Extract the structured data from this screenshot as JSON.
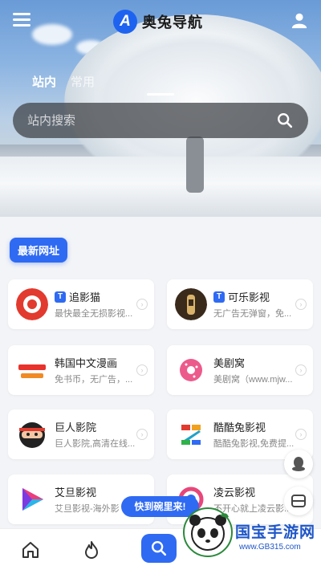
{
  "header": {
    "app_name": "奥兔导航",
    "logo_letter": "A",
    "tabs": [
      {
        "label": "站内",
        "active": true
      },
      {
        "label": "常用",
        "active": false
      }
    ]
  },
  "search": {
    "placeholder": "站内搜索"
  },
  "section": {
    "latest_label": "最新网址"
  },
  "cards": [
    {
      "title": "追影猫",
      "badge": "T",
      "desc": "最快最全无损影视...",
      "icon": "zhuiyingmao-logo"
    },
    {
      "title": "可乐影视",
      "badge": "T",
      "desc": "无广告无弹窗，免...",
      "icon": "kele-bottle-logo"
    },
    {
      "title": "韩国中文漫画",
      "badge": "",
      "desc": "免书币，无广告，...",
      "icon": "toptoon-logo"
    },
    {
      "title": "美剧窝",
      "badge": "",
      "desc": "美剧窝（www.mjw...",
      "icon": "donut-logo"
    },
    {
      "title": "巨人影院",
      "badge": "",
      "desc": "巨人影院,高清在线...",
      "icon": "ninja-logo"
    },
    {
      "title": "酷酷兔影视",
      "badge": "",
      "desc": "酷酷兔影视,免费提...",
      "icon": "z-logo"
    },
    {
      "title": "艾旦影视",
      "badge": "",
      "desc": "艾旦影视-海外影",
      "icon": "play-logo"
    },
    {
      "title": "凌云影视",
      "badge": "",
      "desc": "不开心就上凌云影...",
      "icon": "lingyun-logo"
    }
  ],
  "toast": "快到碗里来!",
  "floating": [
    "qq-icon",
    "message-icon"
  ],
  "bottom_nav": [
    "home-icon",
    "fire-icon",
    "search-icon"
  ],
  "watermark": {
    "text": "国宝手游网",
    "url": "www.GB315.com"
  },
  "colors": {
    "accent": "#2f6af3",
    "background": "#f3f4f7"
  }
}
